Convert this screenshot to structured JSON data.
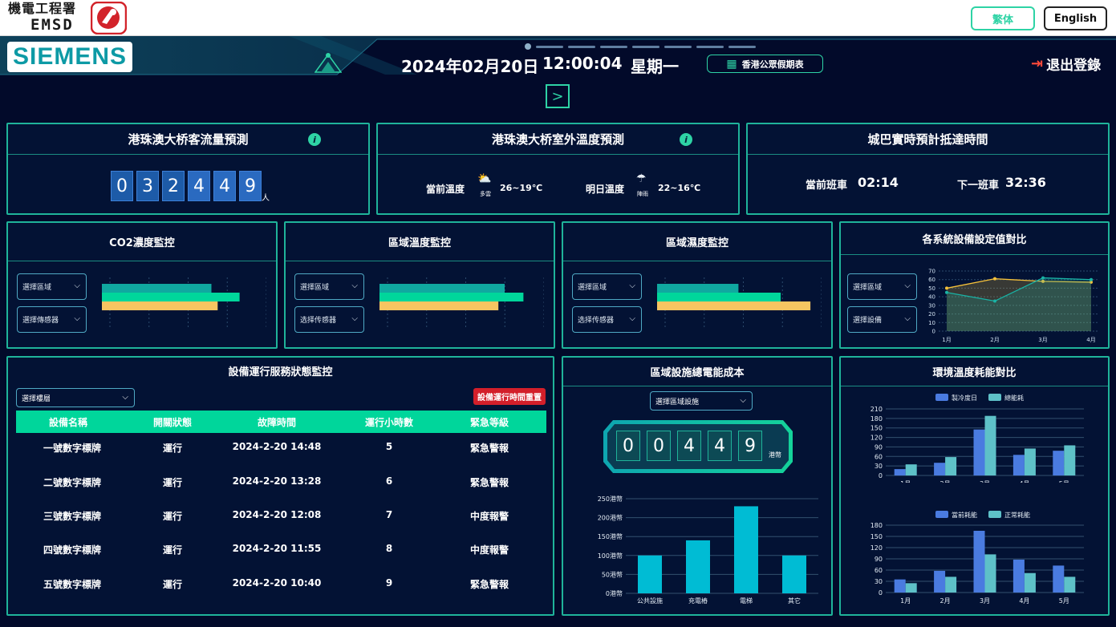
{
  "top_bar": {
    "emsd_cn": "機電工程署",
    "emsd_en": "EMSD",
    "btn_traditional": "繁体",
    "btn_english": "English",
    "colors": {
      "logo_red": "#d2232a",
      "accent": "#2ed3a5"
    }
  },
  "header": {
    "brand": "SIEMENS",
    "date": "2024年02月20日",
    "time": "12:00:04",
    "weekday": "星期一",
    "holiday_btn": "香港公眾假期表",
    "logout": "退出登錄",
    "icons": {
      "holiday": "calendar-icon",
      "logout": "logout-icon",
      "next": "chevron-right-icon"
    }
  },
  "panels": {
    "passenger": {
      "title": "港珠澳大桥客流量預測",
      "digits": [
        "0",
        "3",
        "2",
        "4",
        "4",
        "9"
      ],
      "unit": "人"
    },
    "temperature": {
      "title": "港珠澳大桥室外溫度預測",
      "current_label": "當前溫度",
      "current_weather": "多雲",
      "current_range": "26~19℃",
      "tomorrow_label": "明日溫度",
      "tomorrow_weather": "陣雨",
      "tomorrow_range": "22~16℃"
    },
    "bus": {
      "title": "城巴實時預計抵達時間",
      "current_label": "當前班車",
      "current_value": "02:14",
      "next_label": "下一班車",
      "next_value": "32:36"
    },
    "co2": {
      "title": "CO2濃度監控",
      "select1": "選擇區域",
      "select2": "選擇傳感器"
    },
    "area_temp": {
      "title": "區域溫度監控",
      "select1": "選擇區域",
      "select2": "选择传感器"
    },
    "area_humidity": {
      "title": "區域濕度監控",
      "select1": "選擇區域",
      "select2": "选择传感器"
    },
    "setpoint": {
      "title": "各系統設備設定值對比",
      "select1": "選擇區域",
      "select2": "選擇設備"
    },
    "equipment": {
      "title": "設備運行服務狀態監控",
      "select": "選擇樓層",
      "reset_btn": "設備運行時間重置",
      "headers": [
        "設備名稱",
        "開關狀態",
        "故障時間",
        "運行小時數",
        "緊急等級"
      ],
      "rows": [
        [
          "一號數字標牌",
          "運行",
          "2024-2-20 14:48",
          "5",
          "緊急警報"
        ],
        [
          "二號數字標牌",
          "運行",
          "2024-2-20 13:28",
          "6",
          "緊急警報"
        ],
        [
          "三號數字標牌",
          "運行",
          "2024-2-20 12:08",
          "7",
          "中度報警"
        ],
        [
          "四號數字標牌",
          "運行",
          "2024-2-20 11:55",
          "8",
          "中度報警"
        ],
        [
          "五號數字標牌",
          "運行",
          "2024-2-20 10:40",
          "9",
          "緊急警報"
        ]
      ]
    },
    "energy_cost": {
      "title": "區域設施總電能成本",
      "select": "選擇區域設施",
      "digits": [
        "0",
        "0",
        "4",
        "4",
        "9"
      ],
      "unit": "港幣"
    },
    "env_energy": {
      "title": "環境溫度耗能對比"
    }
  },
  "chart_data": [
    {
      "id": "co2",
      "type": "bar",
      "orientation": "horizontal",
      "values": [
        70,
        88,
        74
      ],
      "xlim": [
        0,
        100
      ],
      "colors": [
        "#10a8a0",
        "#00d69b",
        "#f7c561"
      ],
      "grid": true
    },
    {
      "id": "area_temp",
      "type": "bar",
      "orientation": "horizontal",
      "values": [
        80,
        92,
        76
      ],
      "xlim": [
        0,
        100
      ],
      "colors": [
        "#10a8a0",
        "#00d69b",
        "#f7c561"
      ],
      "grid": true
    },
    {
      "id": "area_humidity",
      "type": "bar",
      "orientation": "horizontal",
      "values": [
        52,
        79,
        98
      ],
      "xlim": [
        0,
        100
      ],
      "colors": [
        "#10a8a0",
        "#00d69b",
        "#f7c561"
      ],
      "grid": true
    },
    {
      "id": "setpoint",
      "type": "line",
      "categories": [
        "1月",
        "2月",
        "3月",
        "4月"
      ],
      "ylim": [
        0,
        70
      ],
      "yticks": [
        0,
        10,
        20,
        30,
        40,
        50,
        60,
        70
      ],
      "series": [
        {
          "values": [
            50,
            61,
            58,
            57
          ],
          "color": "#f7c23a"
        },
        {
          "values": [
            45,
            35,
            62,
            60
          ],
          "color": "#19b3a5"
        }
      ]
    },
    {
      "id": "energy_cost",
      "type": "bar",
      "categories": [
        "公共設施",
        "充電樁",
        "電梯",
        "其它"
      ],
      "values": [
        100,
        140,
        230,
        100
      ],
      "ylim": [
        0,
        250
      ],
      "yticks": [
        "0港幣",
        "50港幣",
        "100港幣",
        "150港幣",
        "200港幣",
        "250港幣"
      ],
      "color": "#00bcd4"
    },
    {
      "id": "env_energy_top",
      "type": "bar",
      "categories": [
        "1月",
        "2月",
        "3月",
        "4月",
        "5月"
      ],
      "ylim": [
        0,
        210
      ],
      "yticks": [
        0,
        30,
        60,
        90,
        120,
        150,
        180,
        210
      ],
      "series": [
        {
          "name": "製冷度日",
          "values": [
            20,
            40,
            145,
            65,
            78
          ],
          "color": "#4a7be0"
        },
        {
          "name": "總能耗",
          "values": [
            35,
            58,
            188,
            85,
            95
          ],
          "color": "#5ec1c8"
        }
      ]
    },
    {
      "id": "env_energy_bottom",
      "type": "bar",
      "categories": [
        "1月",
        "2月",
        "3月",
        "4月",
        "5月"
      ],
      "ylim": [
        0,
        180
      ],
      "yticks": [
        0,
        30,
        60,
        90,
        120,
        150,
        180
      ],
      "series": [
        {
          "name": "當前耗能",
          "values": [
            35,
            58,
            165,
            88,
            72
          ],
          "color": "#4a7be0"
        },
        {
          "name": "正常耗能",
          "values": [
            25,
            42,
            102,
            52,
            42
          ],
          "color": "#5ec1c8"
        }
      ]
    }
  ]
}
